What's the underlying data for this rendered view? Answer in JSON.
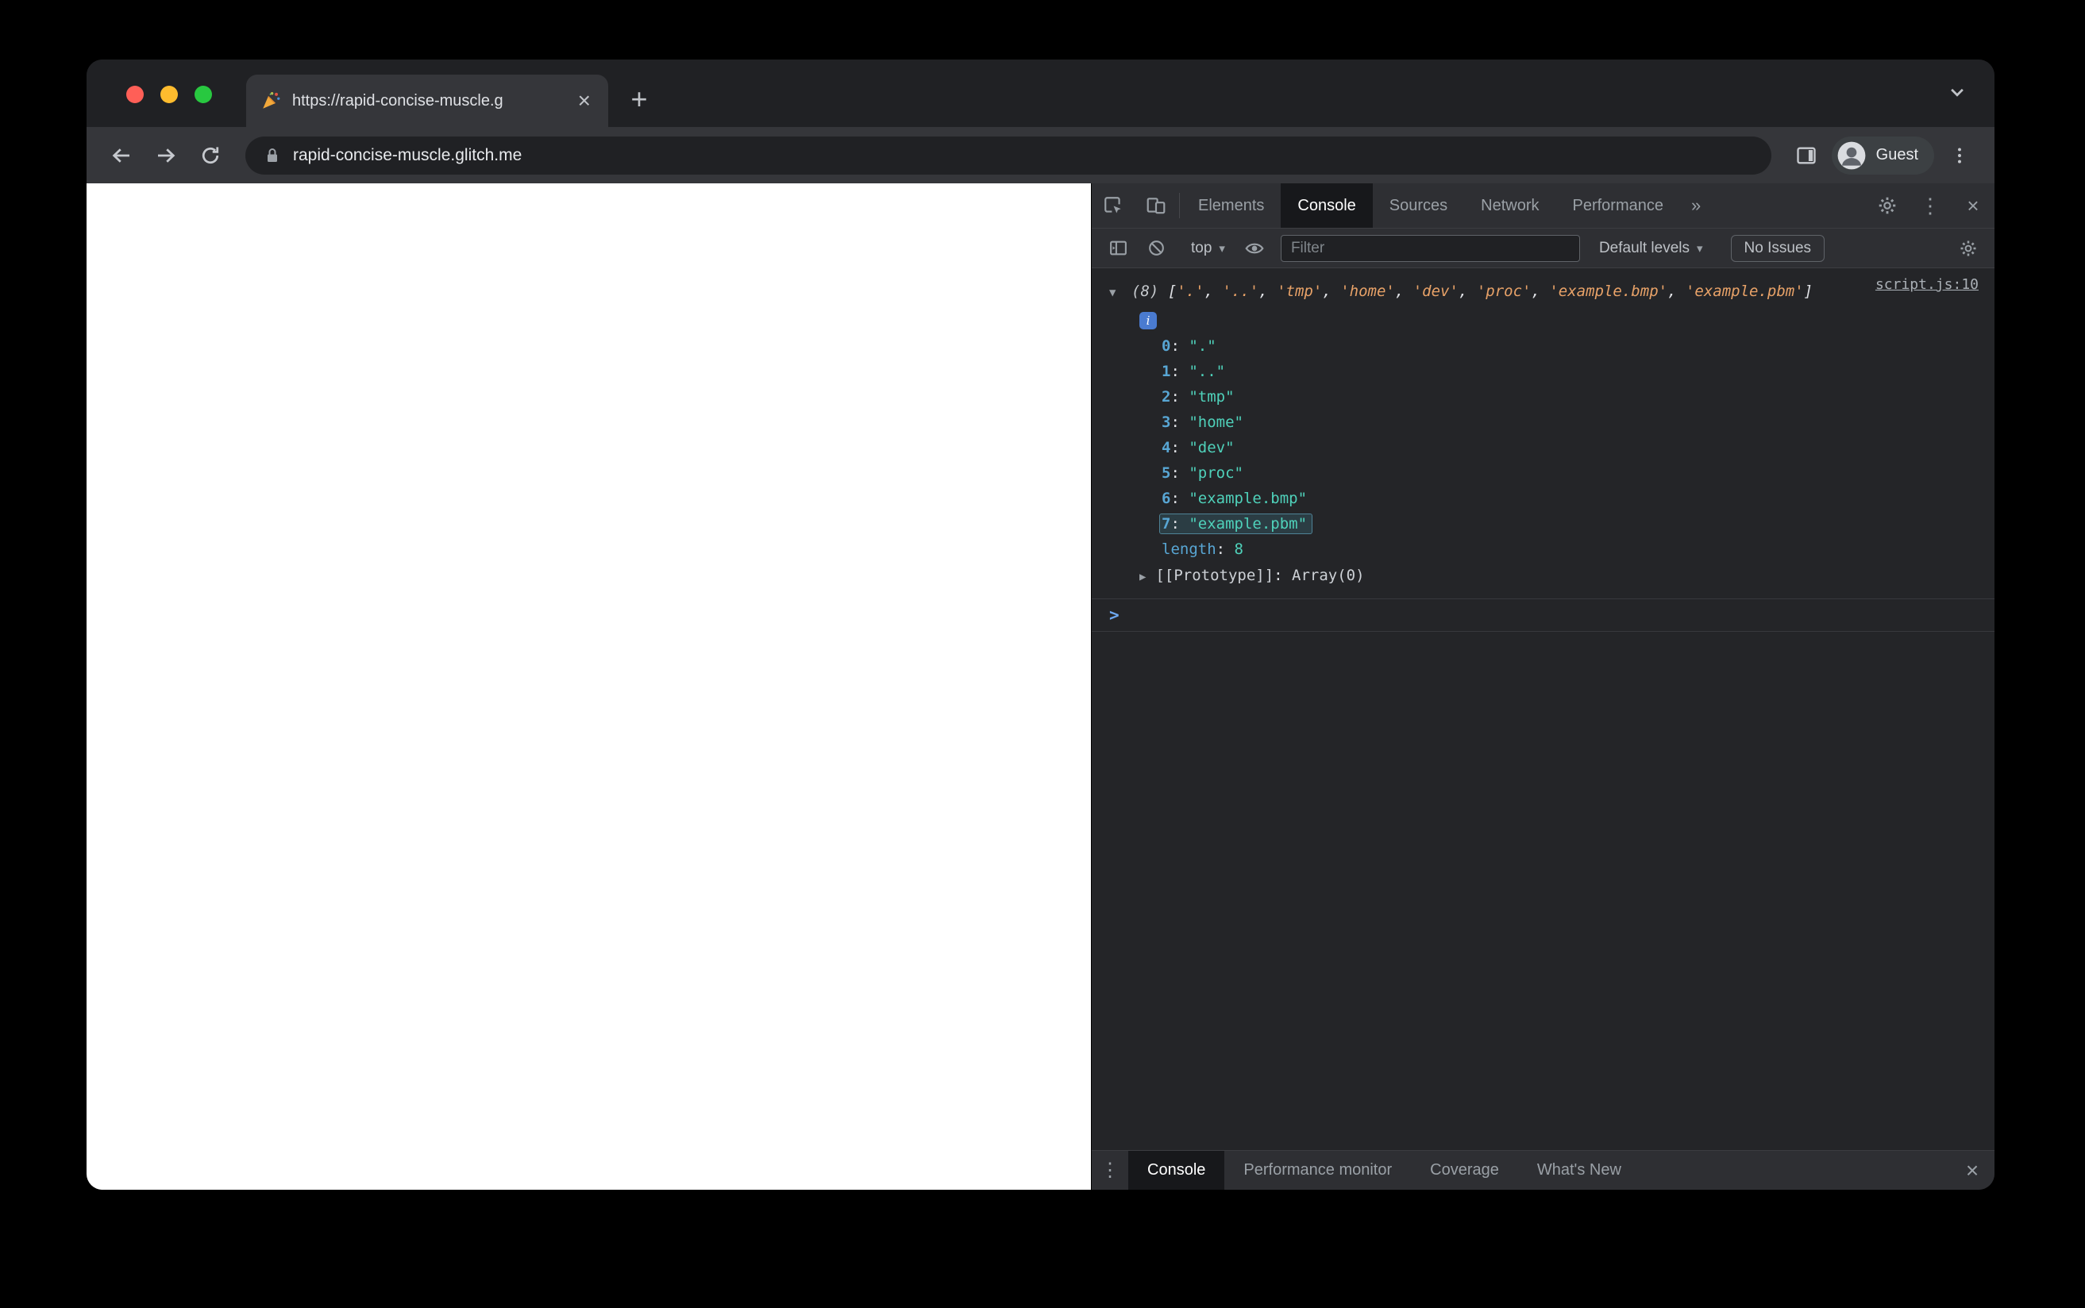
{
  "browser": {
    "tab": {
      "favicon": "party-popper",
      "title": "https://rapid-concise-muscle.g",
      "close_label": "×"
    },
    "new_tab_label": "+",
    "url": "rapid-concise-muscle.glitch.me",
    "profile_label": "Guest"
  },
  "devtools": {
    "tabs": [
      "Elements",
      "Console",
      "Sources",
      "Network",
      "Performance"
    ],
    "active_tab": "Console",
    "more_tabs_label": "»",
    "gear_icon": "settings",
    "console_toolbar": {
      "frame_label": "top",
      "filter_placeholder": "Filter",
      "levels_label": "Default levels",
      "issues_label": "No Issues"
    },
    "console": {
      "source_link": "script.js:10",
      "preview_count": "(8)",
      "preview_open": "[",
      "preview_close": "]",
      "preview_items": [
        "'.'",
        "'..'",
        "'tmp'",
        "'home'",
        "'dev'",
        "'proc'",
        "'example.bmp'",
        "'example.pbm'"
      ],
      "info_icon": "i",
      "entries": [
        {
          "index": "0",
          "value": "\".\"",
          "highlighted": false
        },
        {
          "index": "1",
          "value": "\"..\"",
          "highlighted": false
        },
        {
          "index": "2",
          "value": "\"tmp\"",
          "highlighted": false
        },
        {
          "index": "3",
          "value": "\"home\"",
          "highlighted": false
        },
        {
          "index": "4",
          "value": "\"dev\"",
          "highlighted": false
        },
        {
          "index": "5",
          "value": "\"proc\"",
          "highlighted": false
        },
        {
          "index": "6",
          "value": "\"example.bmp\"",
          "highlighted": false
        },
        {
          "index": "7",
          "value": "\"example.pbm\"",
          "highlighted": true
        }
      ],
      "kv_separator": ": ",
      "length_label": "length",
      "length_value": "8",
      "prototype_label": "[[Prototype]]",
      "prototype_value": "Array(0)",
      "prompt": ">"
    },
    "drawer": {
      "tabs": [
        "Console",
        "Performance monitor",
        "Coverage",
        "What's New"
      ],
      "active_tab": "Console",
      "close_label": "×"
    }
  },
  "colors": {
    "string_preview": "#e8a268",
    "string_value": "#4fd1ba",
    "index": "#58a6d4",
    "highlight_border": "#4e8296",
    "prompt": "#6ea8f0",
    "info_badge": "#4a7bd0",
    "page_bg": "#ffffff",
    "devtools_bg": "#242528",
    "chrome_bg": "#35363a",
    "tabstrip_bg": "#202124"
  }
}
